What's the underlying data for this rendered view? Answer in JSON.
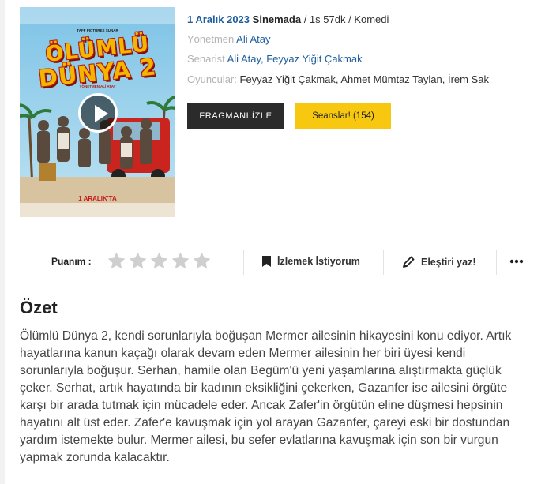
{
  "poster": {
    "title_line1": "ÖLÜMLÜ",
    "title_line2": "DÜNYA 2",
    "date_text": "1 ARALIK'TA",
    "top_credits": "TAFF PICTURES SUNAR",
    "director_credit": "YÖNETMEN ALİ ATAY"
  },
  "movie": {
    "release_date": "1 Aralık 2023",
    "status": "Sinemada",
    "duration_sep": " / ",
    "duration": "1s 57dk",
    "genre": "Komedi",
    "director_label": "Yönetmen",
    "director": "Ali Atay",
    "writer_label": "Senarist",
    "writers": [
      "Ali Atay",
      "Feyyaz Yiğit Çakmak"
    ],
    "writers_sep": ", ",
    "cast_label": "Oyuncular:",
    "cast": "Feyyaz Yiğit Çakmak, Ahmet Mümtaz Taylan, İrem Sak"
  },
  "buttons": {
    "trailer": "FRAGMANI İZLE",
    "sessions": "Seanslar! (154)"
  },
  "action_bar": {
    "rating_label": "Puanım :",
    "star_count": 5,
    "rating_value": 0,
    "watchlist": "İzlemek İstiyorum",
    "review": "Eleştiri yaz!"
  },
  "summary": {
    "heading": "Özet",
    "text": "Ölümlü Dünya 2, kendi sorunlarıyla boğuşan Mermer ailesinin hikayesini konu ediyor. Artık hayatlarına kanun kaçağı olarak devam eden Mermer ailesinin her biri üyesi kendi sorunlarıyla boğuşur. Serhan, hamile olan Begüm'ü yeni yaşamlarına alıştırmakta güçlük çeker. Serhat, artık hayatında bir kadının eksikliğini çekerken, Gazanfer ise ailesini örgüte karşı bir arada tutmak için mücadele eder. Ancak Zafer'in örgütün eline düşmesi hepsinin hayatını alt üst eder. Zafer'e kavuşmak için yol arayan Gazanfer, çareyi eski bir dostundan yardım istemekte bulur. Mermer ailesi, bu sefer evlatlarına kavuşmak için son bir vurgun yapmak zorunda kalacaktır."
  },
  "colors": {
    "accent_blue": "#1f5f9e",
    "yellow_button": "#f7c80f",
    "dark_button": "#2b2b2b",
    "star_empty": "#cfcfcf"
  }
}
